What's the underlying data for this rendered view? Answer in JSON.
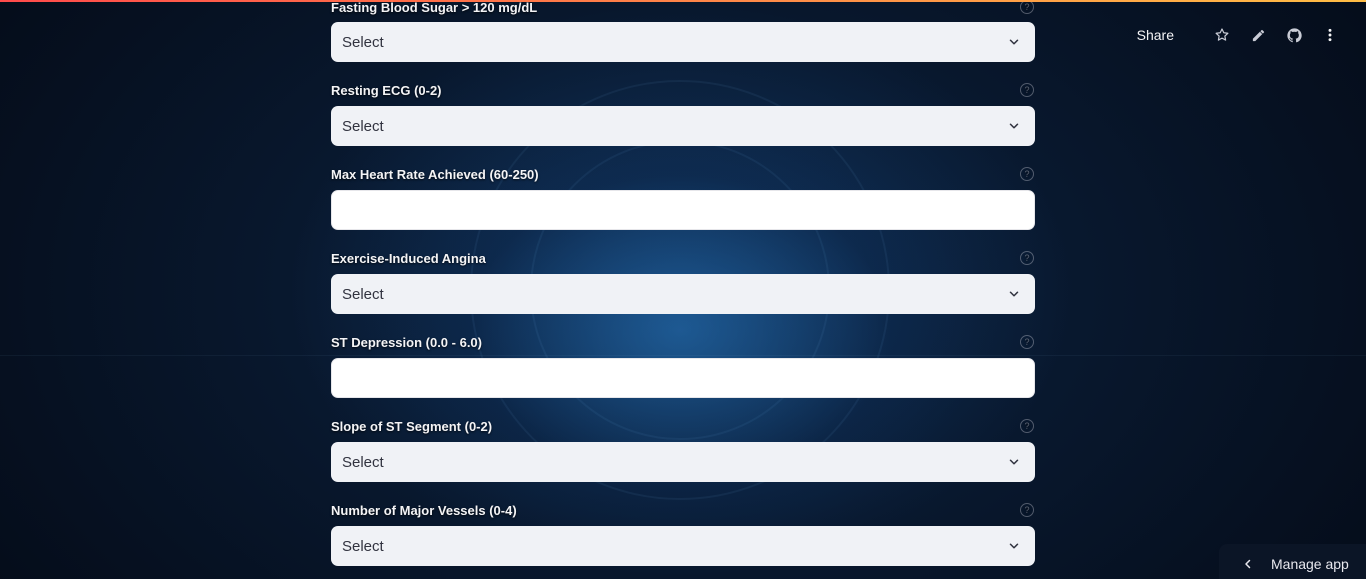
{
  "toolbar": {
    "share_label": "Share",
    "icons": [
      "star-icon",
      "pencil-icon",
      "github-icon",
      "more-vertical-icon"
    ]
  },
  "form": {
    "select_placeholder": "Select",
    "fields": [
      {
        "label": "Fasting Blood Sugar > 120 mg/dL",
        "type": "select",
        "value": "Select"
      },
      {
        "label": "Resting ECG (0-2)",
        "type": "select",
        "value": "Select"
      },
      {
        "label": "Max Heart Rate Achieved (60-250)",
        "type": "number",
        "value": ""
      },
      {
        "label": "Exercise-Induced Angina",
        "type": "select",
        "value": "Select"
      },
      {
        "label": "ST Depression (0.0 - 6.0)",
        "type": "number",
        "value": ""
      },
      {
        "label": "Slope of ST Segment (0-2)",
        "type": "select",
        "value": "Select"
      },
      {
        "label": "Number of Major Vessels (0-4)",
        "type": "select",
        "value": "Select"
      }
    ]
  },
  "footer": {
    "manage_app_label": "Manage app"
  },
  "colors": {
    "accent_gradient_start": "#ff4b4b",
    "accent_gradient_end": "#ffbd45",
    "select_bg": "#f0f2f6",
    "input_bg": "#ffffff",
    "text_dark": "#31333f",
    "label_text": "#f4f4f6"
  }
}
